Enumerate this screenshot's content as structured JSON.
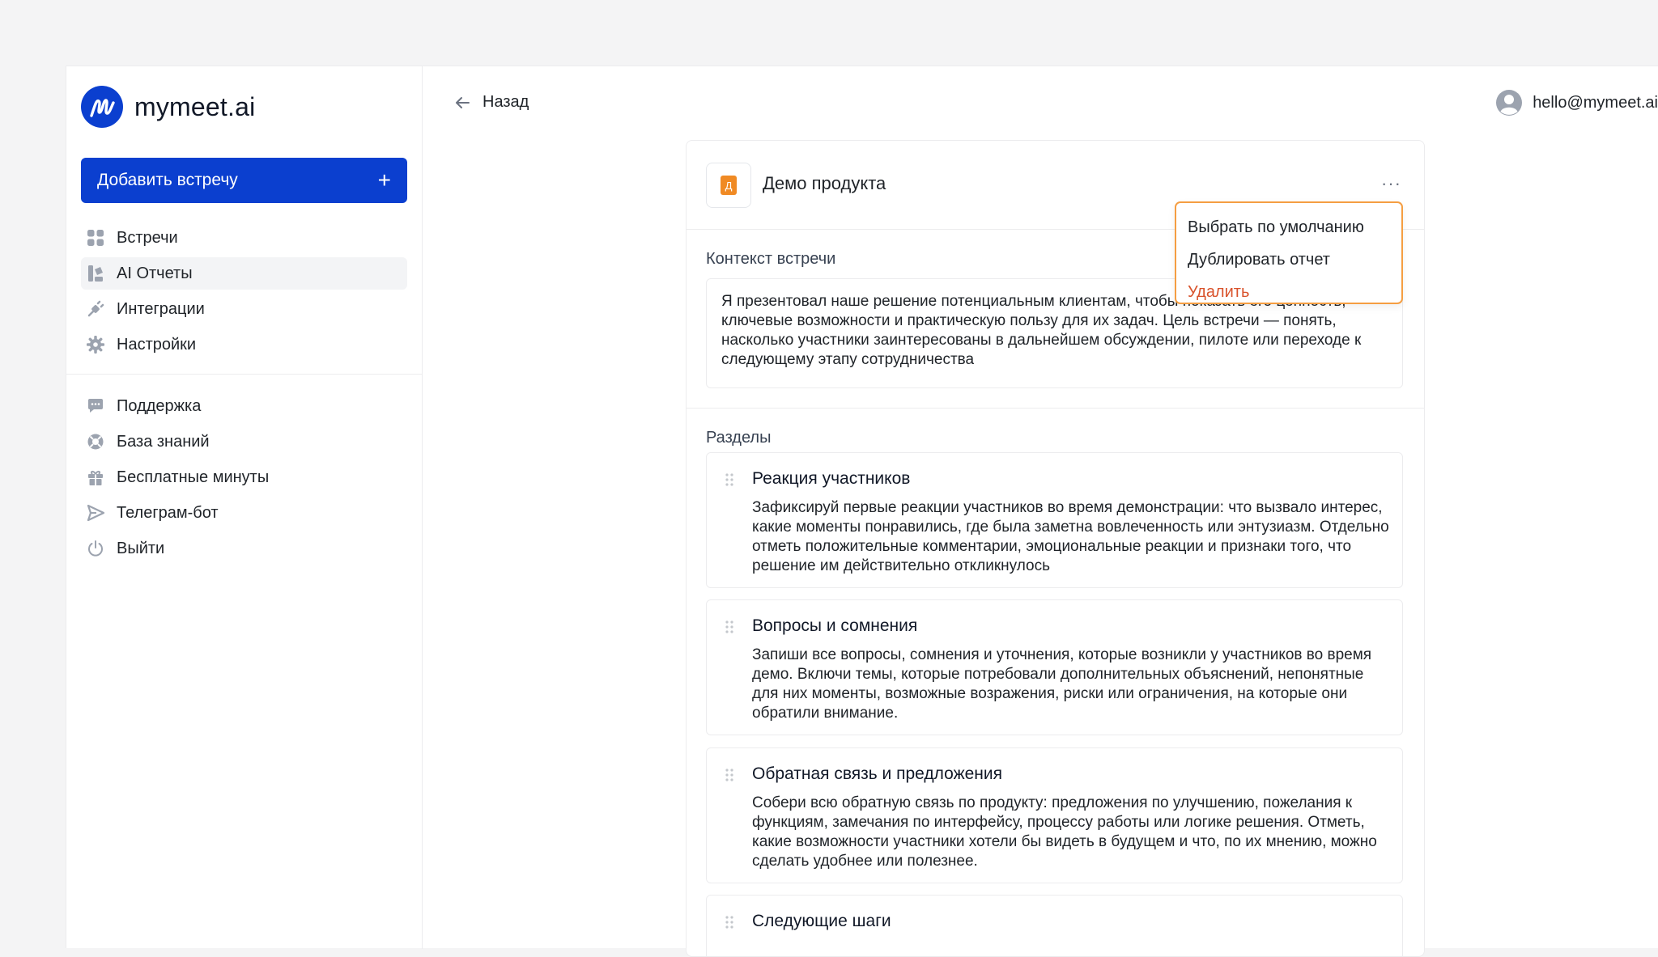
{
  "brand": {
    "name": "mymeet.ai"
  },
  "sidebar": {
    "add_button": "Добавить встречу",
    "add_button_icon": "plus-icon",
    "primary_items": [
      {
        "label": "Встречи",
        "icon": "grid-icon"
      },
      {
        "label": "AI Отчеты",
        "icon": "report-icon",
        "active": true
      },
      {
        "label": "Интеграции",
        "icon": "plug-icon"
      },
      {
        "label": "Настройки",
        "icon": "gear-icon"
      }
    ],
    "secondary_items": [
      {
        "label": "Поддержка",
        "icon": "chat-icon"
      },
      {
        "label": "База знаний",
        "icon": "lifebuoy-icon"
      },
      {
        "label": "Бесплатные минуты",
        "icon": "gift-icon"
      },
      {
        "label": "Телеграм-бот",
        "icon": "send-icon"
      },
      {
        "label": "Выйти",
        "icon": "power-icon"
      }
    ]
  },
  "header": {
    "back_label": "Назад",
    "user_email": "hello@mymeet.ai"
  },
  "report": {
    "badge_letter": "Д",
    "title": "Демо продукта",
    "more_label": "···",
    "context_label": "Контекст встречи",
    "context_text": "Я презентовал наше решение потенциальным клиентам, чтобы показать его ценность, ключевые возможности и практическую пользу для их задач. Цель встречи — понять, насколько участники заинтересованы в дальнейшем обсуждении, пилоте или переходе к следующему этапу сотрудничества",
    "sections_label": "Разделы",
    "sections": [
      {
        "title": "Реакция участников",
        "body": "Зафиксируй первые реакции участников во время демонстрации: что вызвало интерес, какие моменты понравились, где была заметна вовлеченность или энтузиазм. Отдельно отметь положительные комментарии, эмоциональные реакции и признаки того, что решение им действительно откликнулось"
      },
      {
        "title": "Вопросы и сомнения",
        "body": "Запиши все вопросы, сомнения и уточнения, которые возникли у участников во время демо. Включи темы, которые потребовали дополнительных объяснений, непонятные для них моменты, возможные возражения, риски или ограничения, на которые они обратили внимание."
      },
      {
        "title": "Обратная связь и предложения",
        "body": "Собери всю обратную связь по продукту: предложения по улучшению, пожелания к функциям, замечания по интерфейсу, процессу работы или логике решения. Отметь, какие возможности участники хотели бы видеть в будущем и что, по их мнению, можно сделать удобнее или полезнее."
      },
      {
        "title": "Следующие шаги",
        "body": ""
      }
    ]
  },
  "dropdown": {
    "items": [
      {
        "label": "Выбрать по умолчанию"
      },
      {
        "label": "Дублировать отчет"
      },
      {
        "label": "Удалить",
        "danger": true
      }
    ]
  },
  "colors": {
    "accent": "#0b3fcf",
    "highlight_border": "#f59e42",
    "danger": "#d9532c",
    "badge": "#f08a24"
  }
}
